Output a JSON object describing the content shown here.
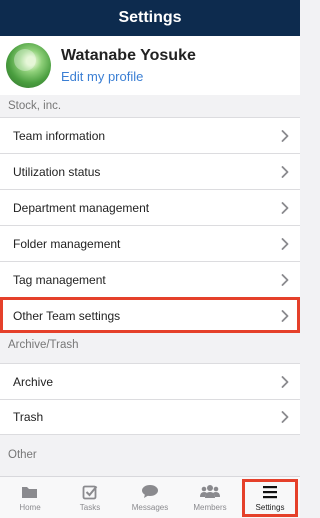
{
  "header": {
    "title": "Settings"
  },
  "profile": {
    "name": "Watanabe Yosuke",
    "edit_link": "Edit my profile"
  },
  "sections": {
    "company": {
      "label": "Stock, inc.",
      "items": [
        "Team information",
        "Utilization status",
        "Department management",
        "Folder management",
        "Tag management",
        "Other Team settings"
      ]
    },
    "archive": {
      "label": "Archive/Trash",
      "items": [
        "Archive",
        "Trash"
      ]
    },
    "other": {
      "label": "Other"
    }
  },
  "tabbar": {
    "items": [
      {
        "label": "Home",
        "icon": "folder-icon"
      },
      {
        "label": "Tasks",
        "icon": "checkbox-icon"
      },
      {
        "label": "Messages",
        "icon": "chat-bubble-icon"
      },
      {
        "label": "Members",
        "icon": "people-icon"
      },
      {
        "label": "Settings",
        "icon": "menu-icon",
        "active": true
      }
    ]
  },
  "colors": {
    "header_bg": "#0d2b4e",
    "link": "#3b7fd4",
    "highlight": "#e5402a"
  }
}
